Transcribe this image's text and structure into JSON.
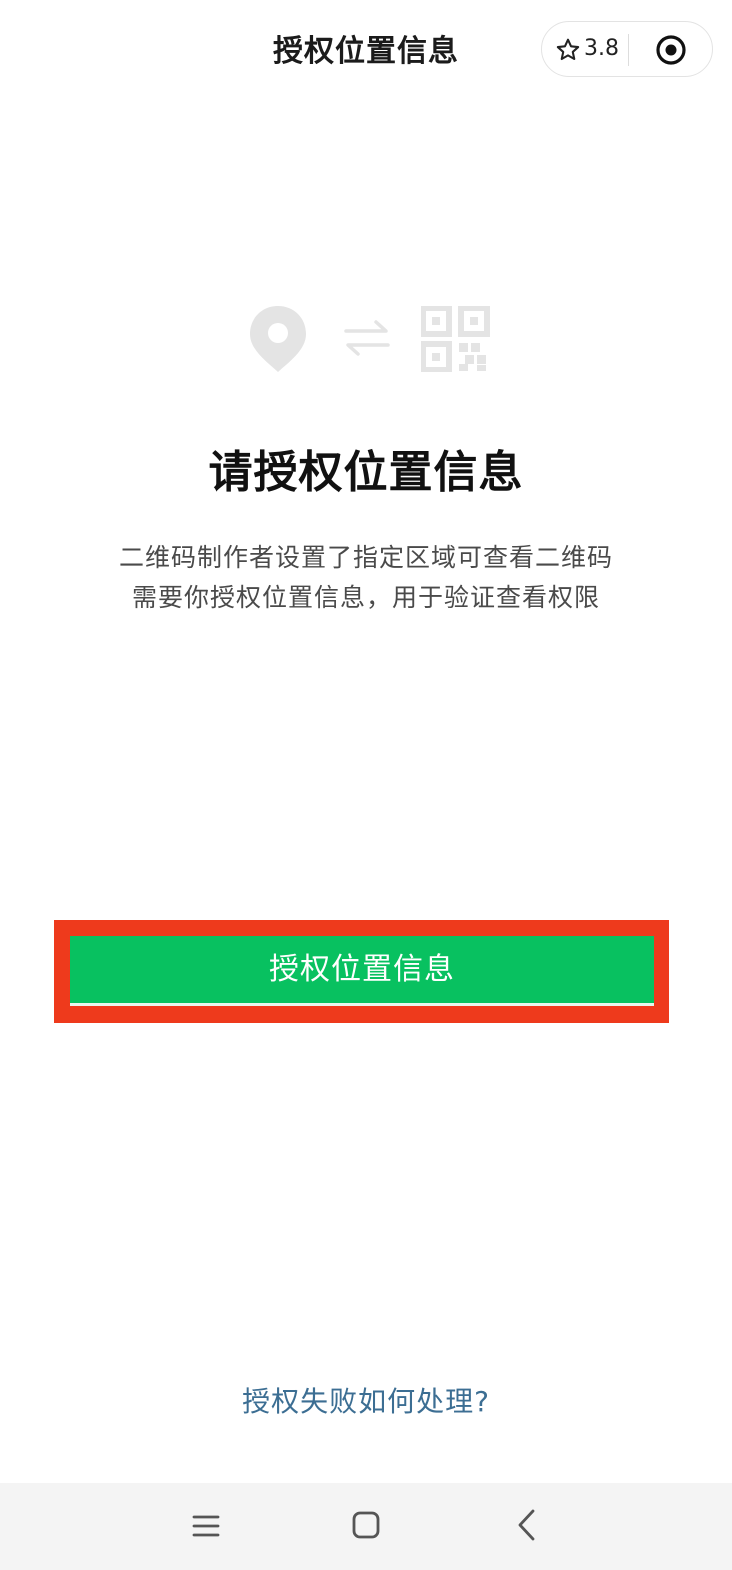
{
  "header": {
    "title": "授权位置信息",
    "rating": "3.8",
    "icons": [
      "star-icon",
      "target-icon"
    ]
  },
  "illustration": {
    "icons": [
      "location-pin-icon",
      "swap-arrows-icon",
      "qr-code-icon"
    ]
  },
  "main": {
    "heading": "请授权位置信息",
    "description_line1": "二维码制作者设置了指定区域可查看二维码",
    "description_line2": "需要你授权位置信息，用于验证查看权限",
    "button_label": "授权位置信息",
    "help_link": "授权失败如何处理?"
  },
  "system_nav": {
    "icons": [
      "menu-icon",
      "home-icon",
      "back-icon"
    ]
  },
  "colors": {
    "primary_button": "#08c160",
    "highlight_border": "#ee3a1c",
    "link": "#3c6e93",
    "illustration_gray": "#e4e4e4"
  }
}
